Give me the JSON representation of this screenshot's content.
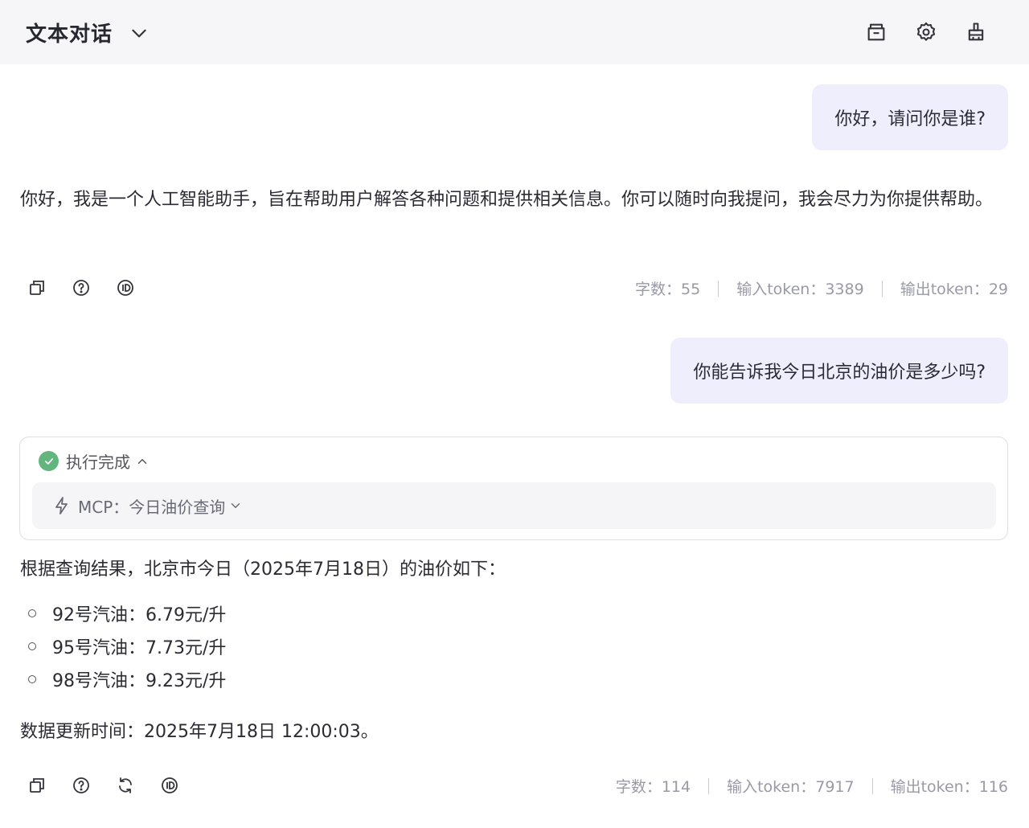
{
  "header": {
    "title": "文本对话",
    "actions": [
      {
        "name": "history-icon"
      },
      {
        "name": "gear-icon"
      },
      {
        "name": "clear-icon"
      }
    ]
  },
  "messages": {
    "user1": "你好，请问你是谁?",
    "assistant1": "你好，我是一个人工智能助手，旨在帮助用户解答各种问题和提供相关信息。你可以随时向我提问，我会尽力为你提供帮助。",
    "stats1": {
      "chars": "字数：55",
      "input_tokens": "输入token：3389",
      "output_tokens": "输出token：29"
    },
    "user2": "你能告诉我今日北京的油价是多少吗?",
    "tool": {
      "status": "执行完成",
      "call_label": "MCP：今日油价查询"
    },
    "assistant2": {
      "intro": "根据查询结果，北京市今日（2025年7月18日）的油价如下：",
      "prices": [
        "92号汽油：6.79元/升",
        "95号汽油：7.73元/升",
        "98号汽油：9.23元/升"
      ],
      "update_time": "数据更新时间：2025年7月18日 12:00:03。"
    },
    "stats2": {
      "chars": "字数：114",
      "input_tokens": "输入token：7917",
      "output_tokens": "输出token：116"
    }
  },
  "colors": {
    "accent_bubble": "#efeefd",
    "success": "#63b57e",
    "muted_text": "#9a9aa6"
  }
}
